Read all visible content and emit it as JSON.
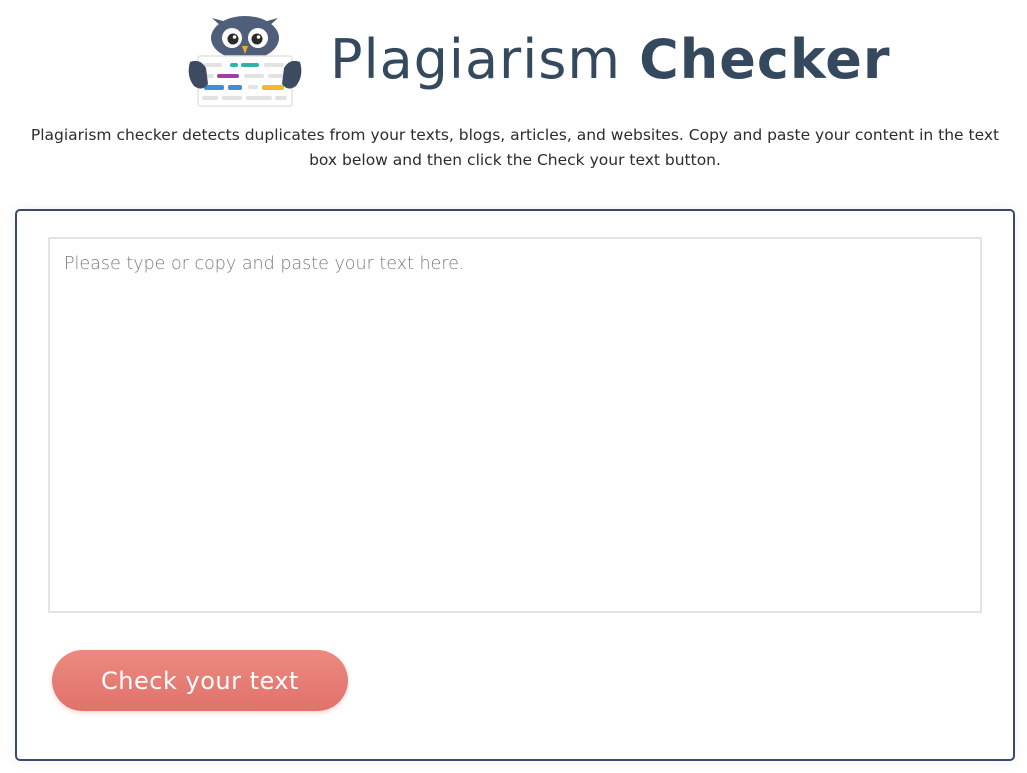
{
  "header": {
    "title_light": "Plagiarism",
    "title_bold": "Checker",
    "logo_icon": "owl-holding-document-icon"
  },
  "description": "Plagiarism checker detects duplicates from your texts, blogs, articles, and websites. Copy and paste your content in the text box below and then click the Check your text button.",
  "editor": {
    "value": "",
    "placeholder": "Please type or copy and paste your text here."
  },
  "actions": {
    "check_label": "Check your text"
  },
  "colors": {
    "title": "#34495e",
    "card_border": "#3a4a6b",
    "button_top": "#ec8a80",
    "button_bottom": "#e0726a",
    "doc_teal": "#2bb5a8",
    "doc_purple": "#a03da8",
    "doc_blue": "#3f8ed8",
    "doc_yellow": "#f2b632"
  }
}
